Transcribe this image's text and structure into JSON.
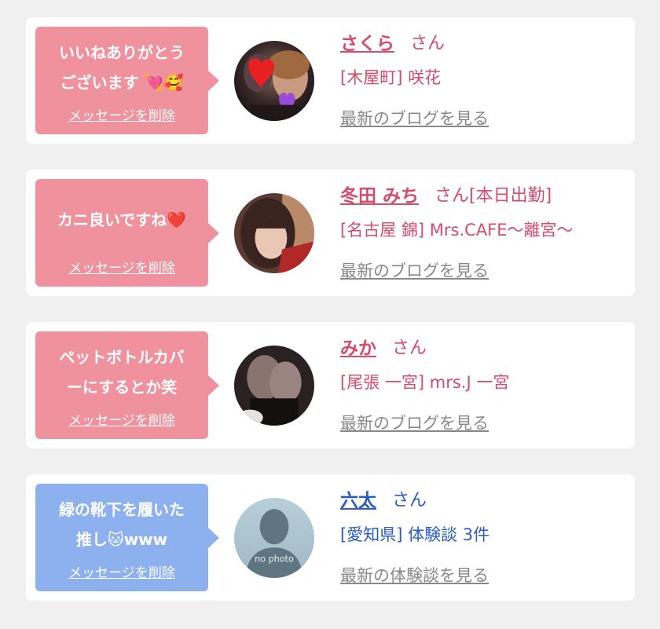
{
  "cards": [
    {
      "message_line1": "いいねありがとう",
      "message_line2": "ございます",
      "message_emoji": "💘🥰",
      "delete_label": "メッセージを削除",
      "name": "さくら",
      "honorific": "さん",
      "status": "",
      "location": "[木屋町]",
      "shop": "咲花",
      "link_label": "最新のブログを見る",
      "theme": "pink",
      "avatar_icon": "photo-with-heart-stickers"
    },
    {
      "message_line1": "カニ良いですね",
      "message_line2": "",
      "message_emoji": "❤️",
      "delete_label": "メッセージを削除",
      "name": "冬田 みち",
      "honorific": "さん",
      "status": "[本日出勤]",
      "location": "[名古屋 錦]",
      "shop": "Mrs.CAFE～離宮～",
      "link_label": "最新のブログを見る",
      "theme": "pink",
      "avatar_icon": "portrait-photo"
    },
    {
      "message_line1": "ペットボトルカバ",
      "message_line2": "ーにするとか笑",
      "message_emoji": "",
      "delete_label": "メッセージを削除",
      "name": "みか",
      "honorific": "さん",
      "status": "",
      "location": "[尾張 一宮]",
      "shop": "mrs.J 一宮",
      "link_label": "最新のブログを見る",
      "theme": "pink",
      "avatar_icon": "legs-photo"
    },
    {
      "message_line1": "緑の靴下を履いた",
      "message_line2": "推し",
      "message_emoji": "🐱",
      "message_suffix": "www",
      "delete_label": "メッセージを削除",
      "name": "六太",
      "honorific": "さん",
      "status": "",
      "location": "[愛知県]",
      "shop": "体験談 3件",
      "link_label": "最新の体験談を見る",
      "theme": "blue",
      "avatar_icon": "no-photo-silhouette",
      "avatar_text": "no photo"
    }
  ],
  "colors": {
    "pink_bubble": "#ef929e",
    "blue_bubble": "#8db1ef",
    "pink_text": "#d64a6a",
    "blue_text": "#2a5cbf",
    "link_gray": "#888888",
    "background": "#f0f0f0"
  }
}
